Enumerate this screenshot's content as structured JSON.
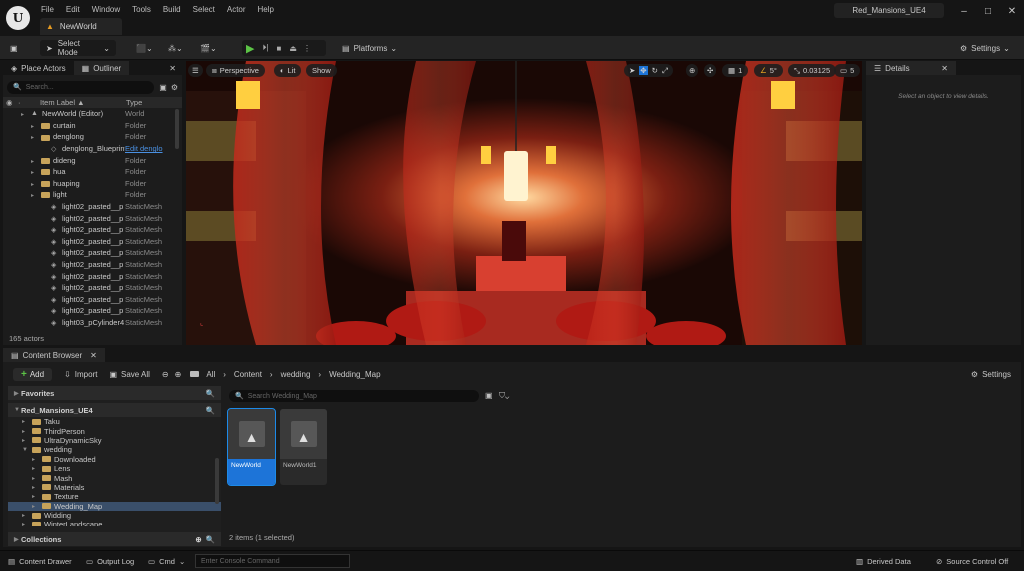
{
  "app": {
    "menu": [
      "File",
      "Edit",
      "Window",
      "Tools",
      "Build",
      "Select",
      "Actor",
      "Help"
    ],
    "doc_tab": "NewWorld",
    "project": "Red_Mansions_UE4"
  },
  "toolbar": {
    "select_mode": "Select Mode",
    "platforms": "Platforms",
    "settings": "Settings"
  },
  "outliner": {
    "tab_place": "Place Actors",
    "tab_outliner": "Outliner",
    "search_placeholder": "Search...",
    "col_label": "Item Label ▲",
    "col_type": "Type",
    "rows": [
      {
        "label": "NewWorld (Editor)",
        "type": "World",
        "indent": 1,
        "kind": "world"
      },
      {
        "label": "curtain",
        "type": "Folder",
        "indent": 2,
        "kind": "folder"
      },
      {
        "label": "denglong",
        "type": "Folder",
        "indent": 2,
        "kind": "folder"
      },
      {
        "label": "denglong_Blueprint",
        "type": "Edit denglo",
        "indent": 3,
        "kind": "bp"
      },
      {
        "label": "dideng",
        "type": "Folder",
        "indent": 2,
        "kind": "folder"
      },
      {
        "label": "hua",
        "type": "Folder",
        "indent": 2,
        "kind": "folder"
      },
      {
        "label": "huaping",
        "type": "Folder",
        "indent": 2,
        "kind": "folder"
      },
      {
        "label": "light",
        "type": "Folder",
        "indent": 2,
        "kind": "folder"
      },
      {
        "label": "light02_pasted__p",
        "type": "StaticMesh",
        "indent": 3,
        "kind": "mesh"
      },
      {
        "label": "light02_pasted__p",
        "type": "StaticMesh",
        "indent": 3,
        "kind": "mesh"
      },
      {
        "label": "light02_pasted__p",
        "type": "StaticMesh",
        "indent": 3,
        "kind": "mesh"
      },
      {
        "label": "light02_pasted__p",
        "type": "StaticMesh",
        "indent": 3,
        "kind": "mesh"
      },
      {
        "label": "light02_pasted__p",
        "type": "StaticMesh",
        "indent": 3,
        "kind": "mesh"
      },
      {
        "label": "light02_pasted__p",
        "type": "StaticMesh",
        "indent": 3,
        "kind": "mesh"
      },
      {
        "label": "light02_pasted__p",
        "type": "StaticMesh",
        "indent": 3,
        "kind": "mesh"
      },
      {
        "label": "light02_pasted__p",
        "type": "StaticMesh",
        "indent": 3,
        "kind": "mesh"
      },
      {
        "label": "light02_pasted__p",
        "type": "StaticMesh",
        "indent": 3,
        "kind": "mesh"
      },
      {
        "label": "light02_pasted__p",
        "type": "StaticMesh",
        "indent": 3,
        "kind": "mesh"
      },
      {
        "label": "light03_pCylinder4",
        "type": "StaticMesh",
        "indent": 3,
        "kind": "mesh"
      }
    ],
    "count": "165 actors"
  },
  "viewport": {
    "perspective": "Perspective",
    "lit": "Lit",
    "show": "Show",
    "grid": "1",
    "angle": "5°",
    "scale": "0.03125",
    "camera": "5"
  },
  "details": {
    "tab": "Details",
    "empty": "Select an object to view details."
  },
  "content_browser": {
    "tab": "Content Browser",
    "add": "Add",
    "import": "Import",
    "save_all": "Save All",
    "breadcrumb": [
      "All",
      "Content",
      "wedding",
      "Wedding_Map"
    ],
    "settings": "Settings",
    "favorites": "Favorites",
    "project": "Red_Mansions_UE4",
    "tree": [
      {
        "label": "Taku",
        "indent": 1,
        "open": false
      },
      {
        "label": "ThirdPerson",
        "indent": 1,
        "open": false
      },
      {
        "label": "UltraDynamicSky",
        "indent": 1,
        "open": false
      },
      {
        "label": "wedding",
        "indent": 1,
        "open": true
      },
      {
        "label": "Downloaded",
        "indent": 2,
        "open": false
      },
      {
        "label": "Lens",
        "indent": 2,
        "open": false
      },
      {
        "label": "Mash",
        "indent": 2,
        "open": false
      },
      {
        "label": "Materials",
        "indent": 2,
        "open": false
      },
      {
        "label": "Texture",
        "indent": 2,
        "open": false
      },
      {
        "label": "Wedding_Map",
        "indent": 2,
        "open": false,
        "selected": true
      },
      {
        "label": "Widding",
        "indent": 1,
        "open": false
      },
      {
        "label": "WinterLandscape",
        "indent": 1,
        "open": false
      }
    ],
    "collections": "Collections",
    "search_placeholder": "Search Wedding_Map",
    "assets": [
      {
        "name": "NewWorld",
        "selected": true
      },
      {
        "name": "NewWorld1",
        "selected": false
      }
    ],
    "item_count": "2 items (1 selected)"
  },
  "statusbar": {
    "content_drawer": "Content Drawer",
    "output_log": "Output Log",
    "cmd": "Cmd",
    "console_placeholder": "Enter Console Command",
    "derived_data": "Derived Data",
    "source_control": "Source Control Off"
  },
  "colors": {
    "accent": "#1d74d8",
    "play": "#5cc446",
    "folder": "#c7a35a"
  }
}
